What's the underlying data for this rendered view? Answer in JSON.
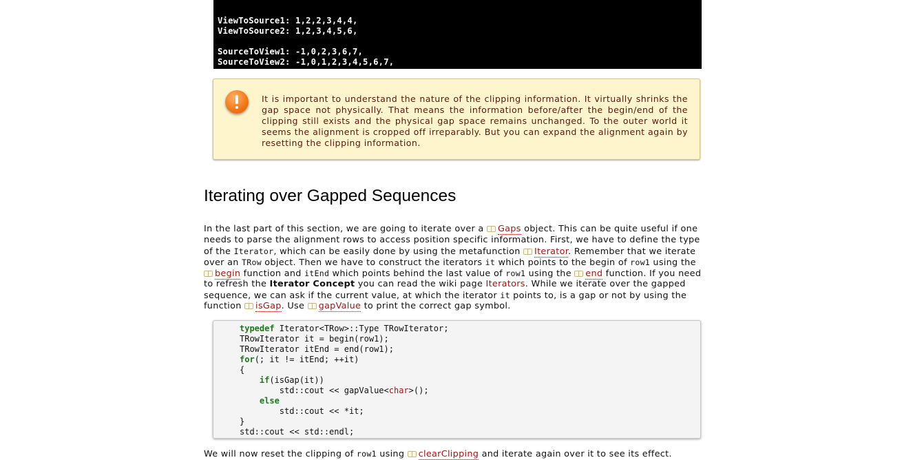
{
  "console": {
    "lines": [
      "ViewToSource1: 1,2,2,3,4,4,",
      "ViewToSource2: 1,2,3,4,5,6,",
      "",
      "SourceToView1: -1,0,2,3,6,7,",
      "SourceToView2: -1,0,1,2,3,4,5,6,7,"
    ]
  },
  "warning": {
    "icon": "exclamation-icon",
    "text": "It is important to understand the nature of the clipping information. It virtually shrinks the gap space not physically. That means the information before/after the begin/end of the clipping still exists and the physical gap space remains unchanged. To the outer world it seems the alignment is cropped off irreparably. But you can expand the alignment again by resetting the clipping information."
  },
  "section": {
    "title": "Iterating over Gapped Sequences"
  },
  "para1": {
    "l1a": "In the last part of this section, we are going to iterate over a ",
    "l1link": "Gaps",
    "l1b": " object. This can be quite useful if one",
    "l2": "needs to parse the alignment rows to access position specific information. First, we have to define the type",
    "l3a": "of the ",
    "l3code": "Iterator",
    "l3b": ", which can be easily done by using the metafunction ",
    "l3link": "Iterator",
    "l3c": ". Remember that we iterate",
    "l4a": "over an ",
    "l4code1": "TRow",
    "l4b": " object. Then we have to construct the iterators ",
    "l4code2": "it",
    "l4c": " which points to the begin of ",
    "l4code3": "row1",
    "l4d": " using the",
    "l5link1": "begin",
    "l5a": " function and ",
    "l5code1": "itEnd",
    "l5b": " which points behind the last value of ",
    "l5code2": "row1",
    "l5c": " using the ",
    "l5link2": "end",
    "l5d": " function. If you need",
    "l6a": "to refresh the ",
    "l6bold": "Iterator Concept",
    "l6b": " you can read the wiki page ",
    "l6link": "Iterators",
    "l6c": ". While we iterate over the gapped",
    "l7a": "sequence, we can ask if the current value, at which the iterator ",
    "l7code": "it",
    "l7b": " points to, is a gap or not by using the",
    "l8a": "function ",
    "l8link1": "isGap",
    "l8b": ". Use ",
    "l8link2": "gapValue",
    "l8c": " to print the correct gap symbol."
  },
  "code": {
    "l1_kw": "typedef",
    "l1_rest": " Iterator<TRow>::Type TRowIterator;",
    "l2": "TRowIterator it = begin(row1);",
    "l3": "TRowIterator itEnd = end(row1);",
    "l4_kw": "for",
    "l4_rest": "(; it != itEnd; ++it)",
    "l5": "{",
    "l6_indent": "    ",
    "l6_kw": "if",
    "l6_rest": "(isGap(it))",
    "l7a": "        std::cout << gapValue<",
    "l7_ty": "char",
    "l7b": ">();",
    "l8_indent": "    ",
    "l8_kw": "else",
    "l9": "        std::cout << *it;",
    "l10": "}",
    "l11": "std::cout << std::endl;"
  },
  "para2": {
    "a": "We will now reset the clipping of ",
    "code": "row1",
    "b": " using ",
    "link": "clearClipping",
    "c": " and iterate again over it to see its effect."
  }
}
